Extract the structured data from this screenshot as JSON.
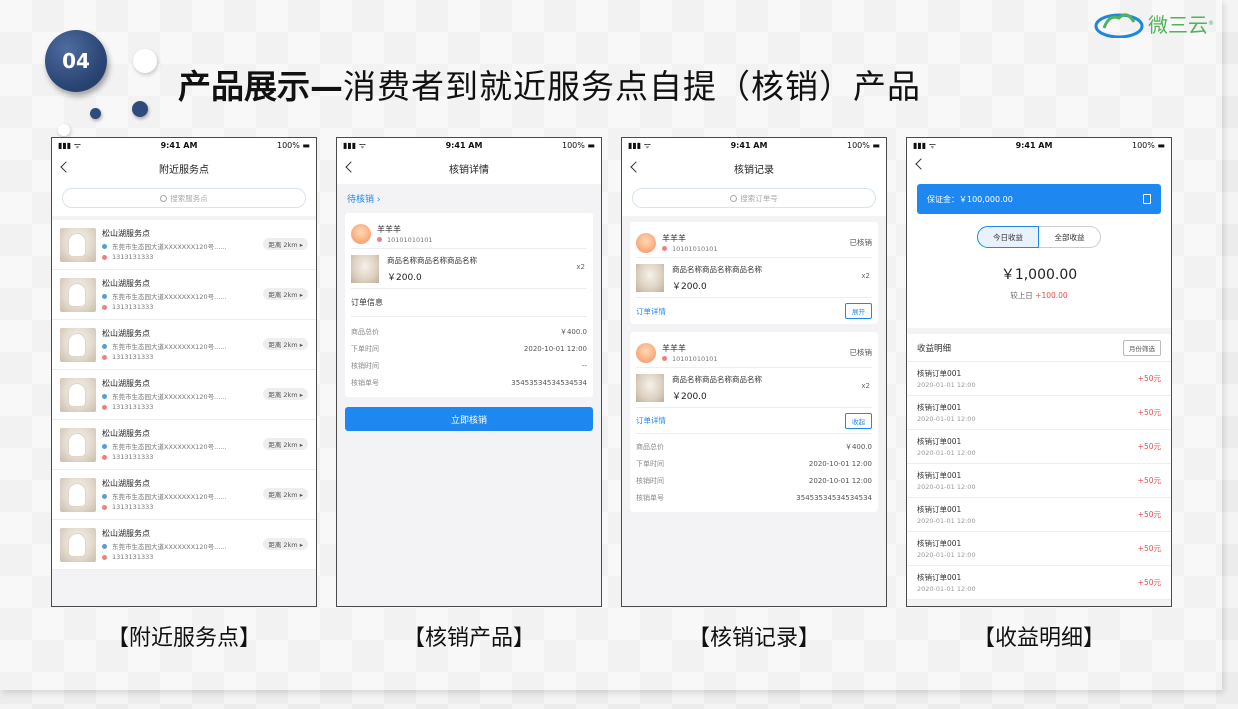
{
  "badge": "04",
  "title": {
    "bold": "产品展示—",
    "rest": "消费者到就近服务点自提（核销）产品"
  },
  "logo": {
    "text": "微三云",
    "reg": "®"
  },
  "status": {
    "time": "9:41 AM",
    "battery": "100%"
  },
  "phone1": {
    "title": "附近服务点",
    "search_placeholder": "搜索服务点",
    "stores": [
      {
        "name": "松山湖服务点",
        "address": "东莞市生态园大道XXXXXXX120号......",
        "phone": "1313131333",
        "distance": "距离 2km"
      },
      {
        "name": "松山湖服务点",
        "address": "东莞市生态园大道XXXXXXX120号......",
        "phone": "1313131333",
        "distance": "距离 2km"
      },
      {
        "name": "松山湖服务点",
        "address": "东莞市生态园大道XXXXXXX120号......",
        "phone": "1313131333",
        "distance": "距离 2km"
      },
      {
        "name": "松山湖服务点",
        "address": "东莞市生态园大道XXXXXXX120号......",
        "phone": "1313131333",
        "distance": "距离 2km"
      },
      {
        "name": "松山湖服务点",
        "address": "东莞市生态园大道XXXXXXX120号......",
        "phone": "1313131333",
        "distance": "距离 2km"
      },
      {
        "name": "松山湖服务点",
        "address": "东莞市生态园大道XXXXXXX120号......",
        "phone": "1313131333",
        "distance": "距离 2km"
      },
      {
        "name": "松山湖服务点",
        "address": "东莞市生态园大道XXXXXXX120号......",
        "phone": "1313131333",
        "distance": "距离 2km"
      }
    ]
  },
  "phone2": {
    "title": "核销详情",
    "pending": "待核销",
    "user_name": "羊羊羊",
    "user_id": "10101010101",
    "product_name": "商品名称商品名称商品名称",
    "price": "￥200.0",
    "qty": "x2",
    "order_info": "订单信息",
    "fields": [
      {
        "k": "商品总价",
        "v": "￥400.0"
      },
      {
        "k": "下单时间",
        "v": "2020-10-01 12:00"
      },
      {
        "k": "核销时间",
        "v": "--"
      },
      {
        "k": "核销单号",
        "v": "35453534534534534"
      }
    ],
    "button": "立即核销"
  },
  "phone3": {
    "title": "核销记录",
    "search_placeholder": "搜索订单号",
    "card1": {
      "user_name": "羊羊羊",
      "user_id": "10101010101",
      "state": "已核销",
      "product_name": "商品名称商品名称商品名称",
      "price": "￥200.0",
      "qty": "x2",
      "detail": "订单详情",
      "action": "展开"
    },
    "card2": {
      "user_name": "羊羊羊",
      "user_id": "10101010101",
      "state": "已核销",
      "product_name": "商品名称商品名称商品名称",
      "price": "￥200.0",
      "qty": "x2",
      "detail": "订单详情",
      "action": "收起",
      "fields": [
        {
          "k": "商品总价",
          "v": "￥400.0"
        },
        {
          "k": "下单时间",
          "v": "2020-10-01 12:00"
        },
        {
          "k": "核销时间",
          "v": "2020-10-01 12:00"
        },
        {
          "k": "核销单号",
          "v": "35453534534534534"
        }
      ]
    }
  },
  "phone4": {
    "deposit": "保证金：￥100,000.00",
    "tab_today": "今日收益",
    "tab_all": "全部收益",
    "amount": "￥1,000.00",
    "compare_label": "较上日",
    "compare_value": "+100.00",
    "income_title": "收益明细",
    "filter": "月份筛选",
    "rows": [
      {
        "title": "核销订单001",
        "date": "2020-01-01 12:00",
        "amount": "+50元"
      },
      {
        "title": "核销订单001",
        "date": "2020-01-01 12:00",
        "amount": "+50元"
      },
      {
        "title": "核销订单001",
        "date": "2020-01-01 12:00",
        "amount": "+50元"
      },
      {
        "title": "核销订单001",
        "date": "2020-01-01 12:00",
        "amount": "+50元"
      },
      {
        "title": "核销订单001",
        "date": "2020-01-01 12:00",
        "amount": "+50元"
      },
      {
        "title": "核销订单001",
        "date": "2020-01-01 12:00",
        "amount": "+50元"
      },
      {
        "title": "核销订单001",
        "date": "2020-01-01 12:00",
        "amount": "+50元"
      }
    ]
  },
  "captions": [
    "【附近服务点】",
    "【核销产品】",
    "【核销记录】",
    "【收益明细】"
  ]
}
